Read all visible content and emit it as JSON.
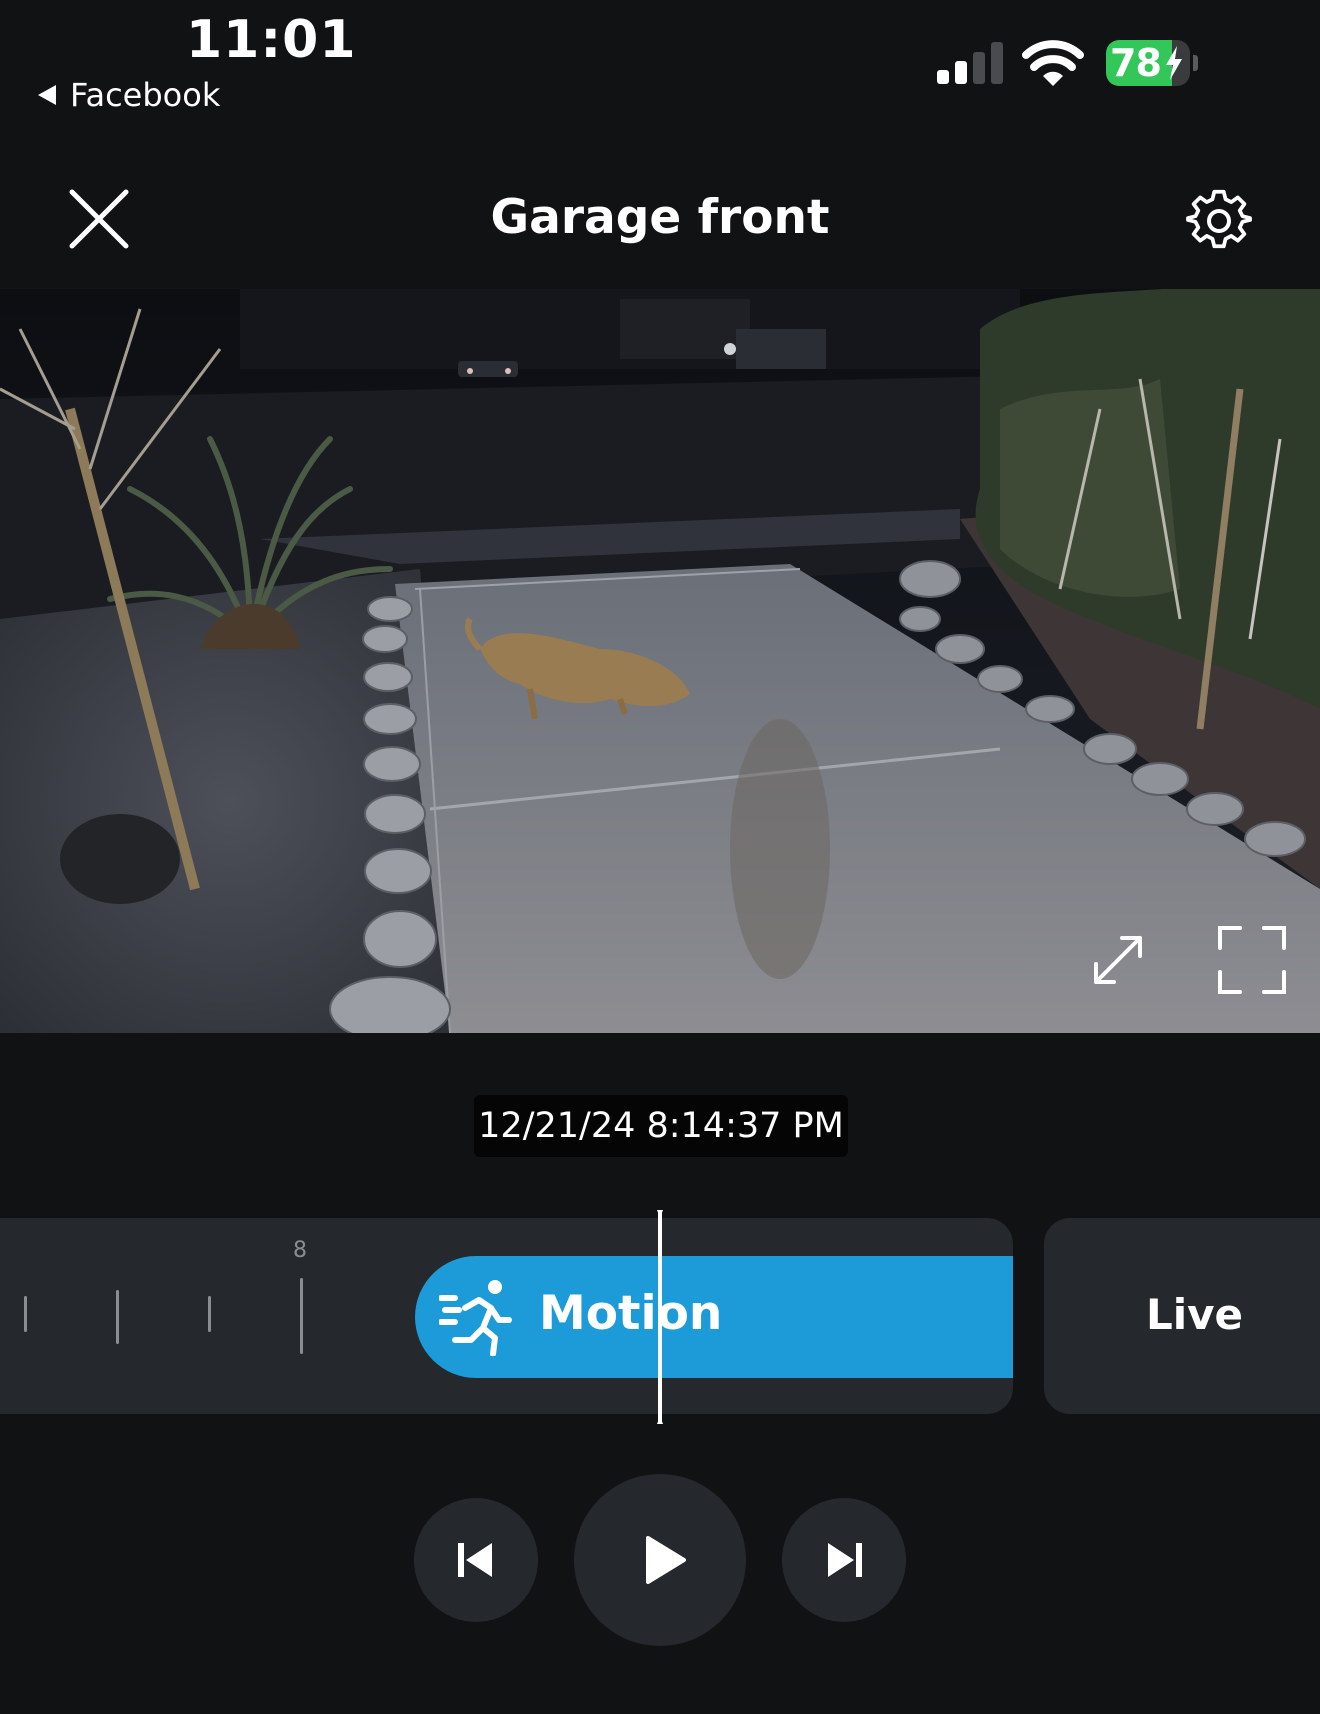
{
  "status_bar": {
    "time": "11:01",
    "back_app": "Facebook",
    "battery_level": "78",
    "battery_fraction": 0.78,
    "battery_color": "#33c75a",
    "charging": true,
    "signal_bars_active": 2,
    "signal_bars_total": 4,
    "icons": [
      "signal-icon",
      "wifi-icon",
      "battery-icon",
      "charging-bolt-icon"
    ]
  },
  "header": {
    "title": "Garage front",
    "close_icon": "close-icon",
    "settings_icon": "gear-icon"
  },
  "video": {
    "pip_icon": "expand-arrows-icon",
    "fullscreen_icon": "fullscreen-corners-icon"
  },
  "playback": {
    "timestamp": "12/21/24 8:14:37 PM"
  },
  "timeline": {
    "tick_label": "8",
    "event_label": "Motion",
    "event_icon": "running-person-icon",
    "event_color": "#1c9bd8",
    "live_label": "Live"
  },
  "controls": {
    "prev_icon": "skip-previous-icon",
    "play_icon": "play-icon",
    "next_icon": "skip-next-icon"
  }
}
